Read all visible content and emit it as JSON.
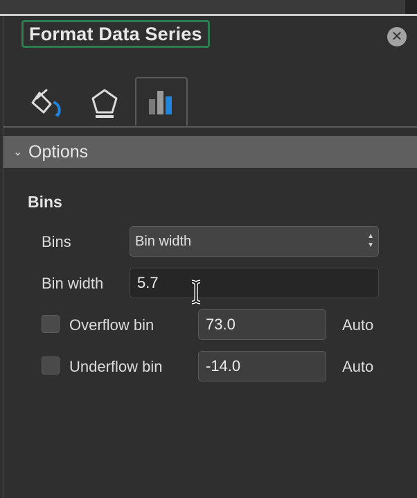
{
  "pane": {
    "title": "Format Data Series",
    "close_icon": "close-icon",
    "tabs": [
      {
        "icon": "fill-line-icon",
        "active": false
      },
      {
        "icon": "effects-pentagon-icon",
        "active": false
      },
      {
        "icon": "series-options-icon",
        "active": true
      }
    ],
    "accent_color": "#2e7d4f",
    "icon_blue": "#1f86e0"
  },
  "options": {
    "header": "Options",
    "section": "Bins",
    "bins_label": "Bins",
    "bins_select_value": "Bin width",
    "bin_width_label": "Bin width",
    "bin_width_value": "5.7",
    "overflow": {
      "label": "Overflow bin",
      "value": "73.0",
      "auto": "Auto",
      "checked": false
    },
    "underflow": {
      "label": "Underflow bin",
      "value": "-14.0",
      "auto": "Auto",
      "checked": false
    }
  }
}
